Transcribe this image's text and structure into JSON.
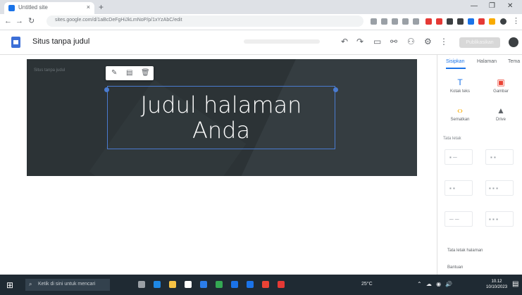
{
  "browser": {
    "tab_title": "Untitled site",
    "tab_close": "×",
    "new_tab": "+",
    "url": "sites.google.com/d/1aBcDeFgHiJkLmNoP/p/1xYzAbC/edit",
    "window_controls": [
      "—",
      "❐",
      "✕"
    ]
  },
  "app": {
    "site_title": "Situs tanpa judul",
    "publish_label": "Publikasikan"
  },
  "hero": {
    "site_name": "Situs tanpa judul",
    "title_line1": "Judul halaman",
    "title_line2": "Anda"
  },
  "side_panel": {
    "tabs": [
      "Sisipkan",
      "Halaman",
      "Tema"
    ],
    "inserts": [
      {
        "label": "Kotak teks",
        "color": "#1a73e8"
      },
      {
        "label": "Gambar",
        "color": "#ea4335"
      },
      {
        "label": "Sematkan",
        "color": "#f9ab00"
      },
      {
        "label": "Drive",
        "color": "#5f6368"
      }
    ],
    "layouts_label": "Tata letak",
    "links": [
      "Tata letak halaman",
      "Bantuan"
    ]
  },
  "taskbar": {
    "search_placeholder": "Ketik di sini untuk mencari",
    "weather": "25°C",
    "time": "10.12",
    "date": "10/10/2023"
  },
  "colors": {
    "accent": "#1a73e8",
    "hero_bg": "#2c3336",
    "selection": "#4a7bd0"
  }
}
